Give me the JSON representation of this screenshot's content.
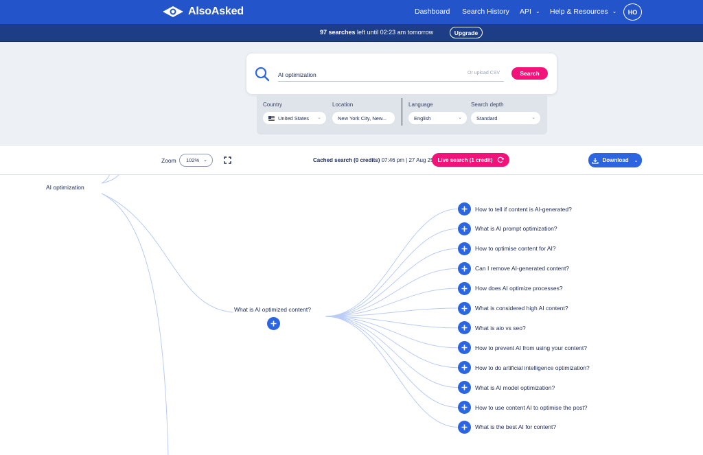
{
  "nav": {
    "logo": "AlsoAsked",
    "links": [
      "Dashboard",
      "Search History",
      "API",
      "Help & Resources"
    ],
    "avatar": "HO"
  },
  "limit_bar": {
    "count": "97 searches",
    "rest": " left until 02:23 am tomorrow",
    "upgrade": "Upgrade"
  },
  "search": {
    "query": "AI optimization",
    "or_upload": "Or upload CSV",
    "button": "Search"
  },
  "filters": {
    "country_label": "Country",
    "country_value": "United States",
    "location_label": "Location",
    "location_value": "New York City, New...",
    "language_label": "Language",
    "language_value": "English",
    "depth_label": "Search depth",
    "depth_value": "Standard"
  },
  "toolbar": {
    "zoom_label": "Zoom",
    "zoom_value": "102%",
    "cached_bold": "Cached search (0 credits)",
    "cached_rest": " 07:46 pm | 27 Aug 25",
    "live_search": "Live search (1 credit)",
    "download": "Download"
  },
  "mindmap": {
    "root": "AI optimization",
    "branch": "What is AI optimized content?",
    "questions": [
      "How to tell if content is AI-generated?",
      "What is AI prompt optimization?",
      "How to optimise content for AI?",
      "Can I remove AI-generated content?",
      "How does AI optimize processes?",
      "What is considered high AI content?",
      "What is aio vs seo?",
      "How to prevent AI from using your content?",
      "How to do artificial intelligence optimization?",
      "What is AI model optimization?",
      "How to use content AI to optimise the post?",
      "What is the best AI for content?"
    ]
  },
  "colors": {
    "nav_blue": "#2354c9",
    "limit_bar": "#1d3e86",
    "accent_pink": "#f2137a",
    "button_blue": "#2b66e0",
    "line_color": "#b9ccf5"
  }
}
